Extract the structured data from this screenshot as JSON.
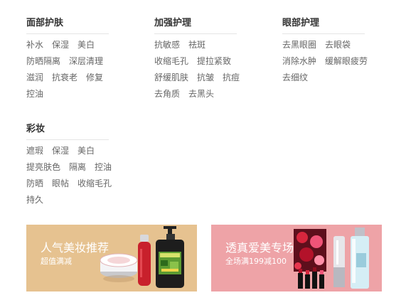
{
  "categories": [
    {
      "title": "面部护肤",
      "rows": [
        [
          "补水",
          "保湿",
          "美白"
        ],
        [
          "防晒隔离",
          "深层清理"
        ],
        [
          "滋润",
          "抗衰老",
          "修复"
        ],
        [
          "控油"
        ]
      ]
    },
    {
      "title": "加强护理",
      "rows": [
        [
          "抗敏感",
          "祛斑"
        ],
        [
          "收缩毛孔",
          "提拉紧致"
        ],
        [
          "舒缓肌肤",
          "抗皱",
          "抗痘"
        ],
        [
          "去角质",
          "去黑头"
        ]
      ]
    },
    {
      "title": "眼部护理",
      "rows": [
        [
          "去黑眼圈",
          "去眼袋"
        ],
        [
          "消除水肿",
          "缓解眼疲劳"
        ],
        [
          "去细纹"
        ]
      ]
    },
    {
      "title": "彩妆",
      "rows": [
        [
          "遮瑕",
          "保湿",
          "美白"
        ],
        [
          "提亮肤色",
          "隔离",
          "控油"
        ],
        [
          "防晒",
          "眼帖",
          "收缩毛孔"
        ],
        [
          "持久"
        ]
      ]
    }
  ],
  "banners": [
    {
      "title": "人气美妆推荐",
      "subtitle": "超值满减",
      "color": "#e6c290"
    },
    {
      "title": "透真爱美专场",
      "subtitle": "全场满199减100",
      "color": "#eea3a7"
    }
  ]
}
